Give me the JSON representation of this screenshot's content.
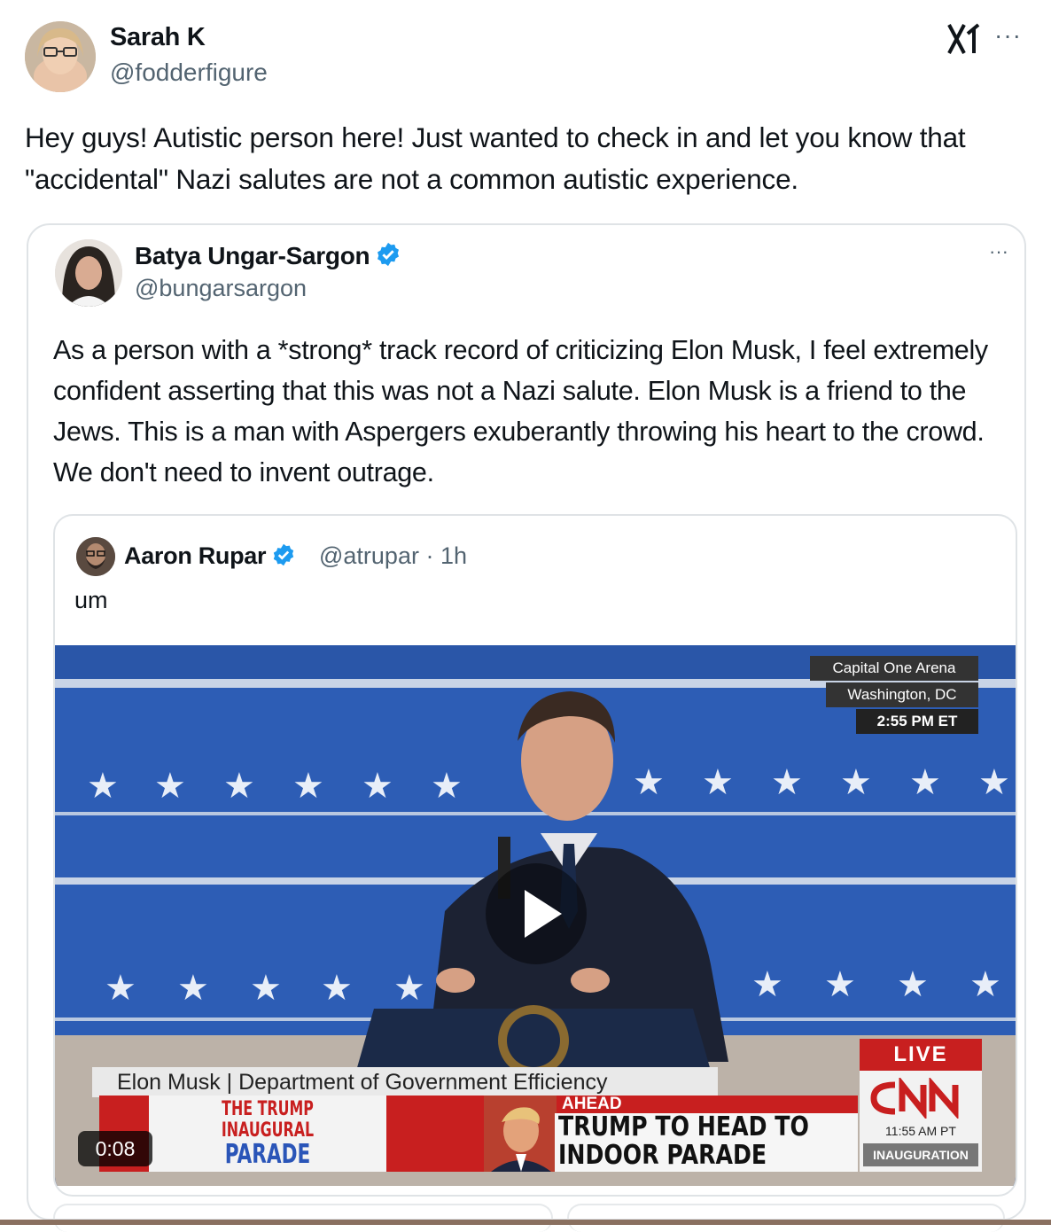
{
  "post": {
    "author_name": "Sarah K",
    "author_handle": "@fodderfigure",
    "more_label": "···",
    "text": "Hey guys! Autistic person here! Just wanted to check in and let you know that \"accidental\" Nazi salutes are not a common autistic experience."
  },
  "quoted_post": {
    "author_name": "Batya Ungar-Sargon",
    "author_handle": "@bungarsargon",
    "more_label": "···",
    "text": "As a person with a *strong* track record of criticizing Elon Musk, I feel extremely confident asserting that this was not a Nazi salute. Elon Musk is a friend to the Jews. This is a man with Aspergers exuberantly throwing his heart to the crowd. We don't need to invent outrage."
  },
  "nested_post": {
    "author_name": "Aaron Rupar",
    "author_handle_time": "@atrupar · 1h",
    "text": "um"
  },
  "video": {
    "timestamp": "0:08",
    "location_line1": "Capital One Arena",
    "location_line2": "Washington, DC",
    "location_time": "2:55 PM ET",
    "chyron_name": "Elon Musk  |  Department of Government Efficiency",
    "parade_line1": "THE TRUMP",
    "parade_line2": "INAUGURAL",
    "parade_line3": "PARADE",
    "ahead_label": "AHEAD",
    "headline_line1": "TRUMP TO HEAD TO",
    "headline_line2": "INDOOR PARADE",
    "live_label": "LIVE",
    "network_time": "11:55 AM PT",
    "network_tag": "INAUGURATION"
  },
  "colors": {
    "verified_blue": "#1d9bf0",
    "stage_blue": "#2a5bb0",
    "cnn_red": "#c81f1f"
  }
}
